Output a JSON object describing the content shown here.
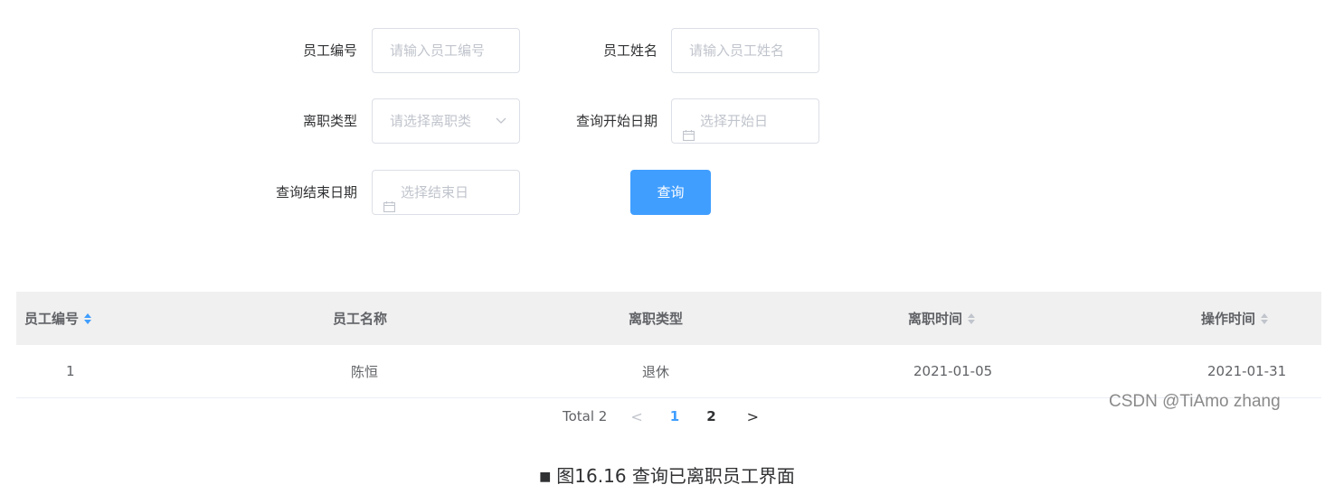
{
  "form": {
    "employee_no_label": "员工编号",
    "employee_no_placeholder": "请输入员工编号",
    "employee_name_label": "员工姓名",
    "employee_name_placeholder": "请输入员工姓名",
    "leave_type_label": "离职类型",
    "leave_type_placeholder": "请选择离职类",
    "start_date_label": "查询开始日期",
    "start_date_placeholder": "选择开始日",
    "end_date_label": "查询结束日期",
    "end_date_placeholder": "选择结束日",
    "query_button": "查询"
  },
  "table": {
    "columns": [
      "员工编号",
      "员工名称",
      "离职类型",
      "离职时间",
      "操作时间"
    ],
    "rows": [
      [
        "1",
        "陈恒",
        "退休",
        "2021-01-05",
        "2021-01-31"
      ]
    ]
  },
  "pagination": {
    "total_text": "Total 2",
    "prev": "<",
    "pages": [
      "1",
      "2"
    ],
    "current": "1",
    "next": ">"
  },
  "watermark": "CSDN @TiAmo zhang",
  "caption": {
    "bullet": "■",
    "text": "图16.16 查询已离职员工界面"
  },
  "colors": {
    "primary": "#409eff",
    "header_bg": "#f0f0f0",
    "border": "#dcdfe6",
    "placeholder": "#c0c4cc"
  }
}
